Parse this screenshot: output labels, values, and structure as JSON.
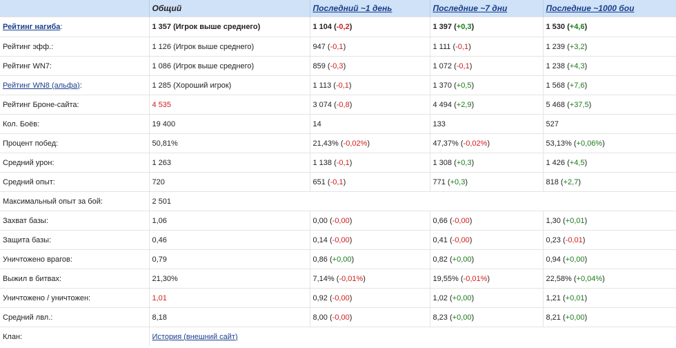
{
  "header": {
    "col1": "Общий",
    "col2": "Последний ~1 день",
    "col3": "Последние ~7 дни",
    "col4": "Последние ~1000 бои"
  },
  "rows": [
    {
      "label": "Рейтинг нагиба",
      "label_link": true,
      "bold": true,
      "overall": "1 357 (Игрок выше среднего)",
      "d1": {
        "v": "1 104",
        "d": "-0,2"
      },
      "d7": {
        "v": "1 397",
        "d": "+0,3"
      },
      "b1000": {
        "v": "1 530",
        "d": "+4,6"
      }
    },
    {
      "label": "Рейтинг эфф.:",
      "overall": "1 126 (Игрок выше среднего)",
      "d1": {
        "v": "947",
        "d": "-0,1"
      },
      "d7": {
        "v": "1 111",
        "d": "-0,1"
      },
      "b1000": {
        "v": "1 239",
        "d": "+3,2"
      }
    },
    {
      "label": "Рейтинг WN7:",
      "overall": "1 086 (Игрок выше среднего)",
      "d1": {
        "v": "859",
        "d": "-0,3"
      },
      "d7": {
        "v": "1 072",
        "d": "-0,1"
      },
      "b1000": {
        "v": "1 238",
        "d": "+4,3"
      }
    },
    {
      "label": "Рейтинг WN8 (альфа)",
      "label_link": true,
      "overall": "1 285 (Хороший игрок)",
      "d1": {
        "v": "1 113",
        "d": "-0,1"
      },
      "d7": {
        "v": "1 370",
        "d": "+0,5"
      },
      "b1000": {
        "v": "1 568",
        "d": "+7,6"
      }
    },
    {
      "label": "Рейтинг Броне-сайта:",
      "overall": "4 535",
      "overall_red": true,
      "d1": {
        "v": "3 074",
        "d": "-0,8"
      },
      "d7": {
        "v": "4 494",
        "d": "+2,9"
      },
      "b1000": {
        "v": "5 468",
        "d": "+37,5"
      }
    },
    {
      "label": "Кол. Боёв:",
      "overall": "19 400",
      "d1": {
        "v": "14",
        "d": ""
      },
      "d7": {
        "v": "133",
        "d": ""
      },
      "b1000": {
        "v": "527",
        "d": ""
      }
    },
    {
      "label": "Процент побед:",
      "overall": "50,81%",
      "d1": {
        "v": "21,43%",
        "d": "-0,02%"
      },
      "d7": {
        "v": "47,37%",
        "d": "-0,02%"
      },
      "b1000": {
        "v": "53,13%",
        "d": "+0,06%"
      }
    },
    {
      "label": "Средний урон:",
      "overall": "1 263",
      "d1": {
        "v": "1 138",
        "d": "-0,1"
      },
      "d7": {
        "v": "1 308",
        "d": "+0,3"
      },
      "b1000": {
        "v": "1 426",
        "d": "+4,5"
      }
    },
    {
      "label": "Средний опыт:",
      "overall": "720",
      "d1": {
        "v": "651",
        "d": "-0,1"
      },
      "d7": {
        "v": "771",
        "d": "+0,3"
      },
      "b1000": {
        "v": "818",
        "d": "+2,7"
      }
    },
    {
      "label": "Максимальный опыт за бой:",
      "overall": "2 501",
      "span": true
    },
    {
      "label": "Захват базы:",
      "overall": "1,06",
      "d1": {
        "v": "0,00",
        "d": "-0,00"
      },
      "d7": {
        "v": "0,66",
        "d": "-0,00"
      },
      "b1000": {
        "v": "1,30",
        "d": "+0,01"
      }
    },
    {
      "label": "Защита базы:",
      "overall": "0,46",
      "d1": {
        "v": "0,14",
        "d": "-0,00"
      },
      "d7": {
        "v": "0,41",
        "d": "-0,00"
      },
      "b1000": {
        "v": "0,23",
        "d": "-0,01"
      }
    },
    {
      "label": "Уничтожено врагов:",
      "overall": "0,79",
      "d1": {
        "v": "0,86",
        "d": "+0,00"
      },
      "d7": {
        "v": "0,82",
        "d": "+0,00"
      },
      "b1000": {
        "v": "0,94",
        "d": "+0,00"
      }
    },
    {
      "label": "Выжил в битвах:",
      "overall": "21,30%",
      "d1": {
        "v": "7,14%",
        "d": "-0,01%"
      },
      "d7": {
        "v": "19,55%",
        "d": "-0,01%"
      },
      "b1000": {
        "v": "22,58%",
        "d": "+0,04%"
      }
    },
    {
      "label": "Уничтожено / уничтожен:",
      "overall": "1,01",
      "overall_red": true,
      "d1": {
        "v": "0,92",
        "d": "-0,00"
      },
      "d7": {
        "v": "1,02",
        "d": "+0,00"
      },
      "b1000": {
        "v": "1,21",
        "d": "+0,01"
      }
    },
    {
      "label": "Средний лвл.:",
      "overall": "8,18",
      "d1": {
        "v": "8,00",
        "d": "-0,00"
      },
      "d7": {
        "v": "8,23",
        "d": "+0,00"
      },
      "b1000": {
        "v": "8,21",
        "d": "+0,00"
      }
    },
    {
      "label": "Клан:",
      "overall": "История (внешний сайт)",
      "overall_link": true,
      "span": true
    }
  ],
  "colors": {
    "header_bg": "#cfe2f7",
    "negative": "#d11c1c",
    "positive": "#1a7a1a",
    "link": "#1a3f8c"
  }
}
